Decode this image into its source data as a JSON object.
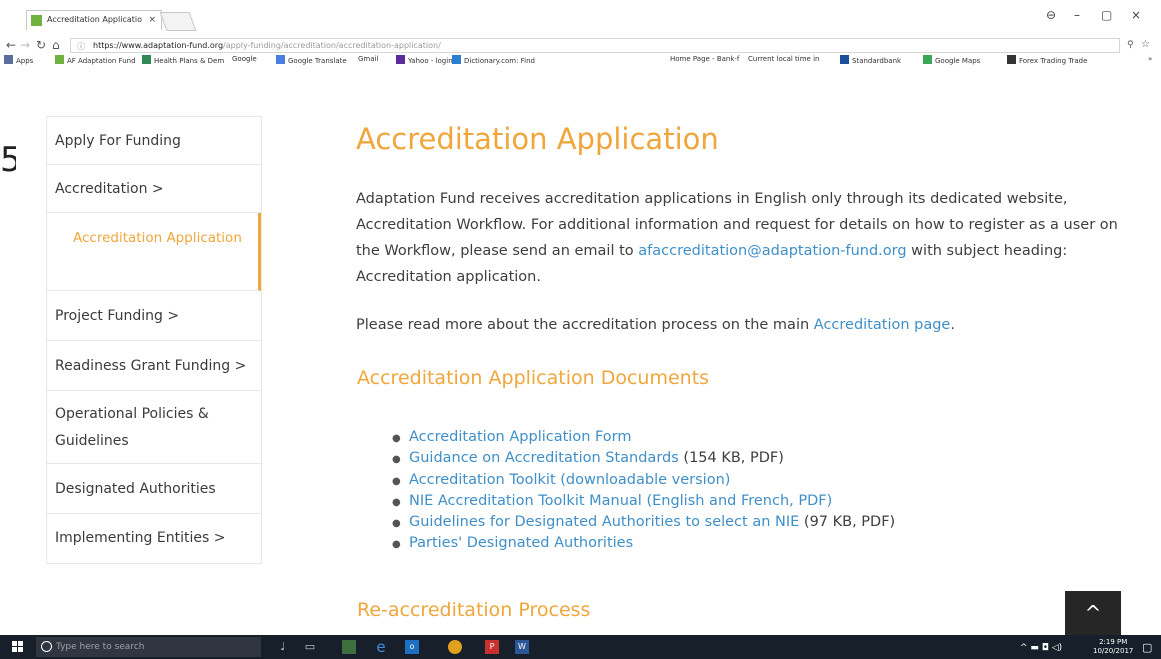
{
  "browser": {
    "tab_title": "Accreditation Applicatio",
    "tab_close": "×",
    "url_host": "https://www.adaptation-fund.org",
    "url_path": "/apply-funding/accreditation/accreditation-application/",
    "bookmarks": [
      "Apps",
      "AF Adaptation Fund",
      "Health Plans & Dem",
      "Google",
      "Google Translate",
      "Gmail",
      "Yahoo - login",
      "Dictionary.com: Find",
      "Home Page - Bank-f",
      "Current local time in",
      "Standardbank",
      "Google Maps",
      "Forex Trading Trade",
      "»"
    ]
  },
  "sidebar": {
    "items": [
      {
        "label": "Apply For Funding"
      },
      {
        "label": "Accreditation  >"
      },
      {
        "label": "Accreditation Application"
      },
      {
        "label": "Project Funding  >"
      },
      {
        "label": "Readiness Grant Funding  >"
      },
      {
        "label": "Operational Policies & Guidelines"
      },
      {
        "label": "Designated Authorities"
      },
      {
        "label": "Implementing Entities  >"
      }
    ]
  },
  "main": {
    "title": "Accreditation Application",
    "intro_1": "Adaptation Fund receives accreditation applications in English only through its dedicated website, Accreditation Workflow. For additional information and request for details on how to register as a user on the Workflow, please send an email to ",
    "intro_email": "afaccreditation@adaptation-fund.org",
    "intro_2": " with subject heading: Accreditation application.",
    "read_more_1": "Please read more about the accreditation process on the main ",
    "read_more_link": "Accreditation page",
    "read_more_2": ".",
    "docs_heading": "Accreditation Application Documents",
    "docs": [
      {
        "link": "Accreditation Application Form",
        "note": ""
      },
      {
        "link": "Guidance on Accreditation Standards",
        "note": " (154 KB, PDF)"
      },
      {
        "link": "Accreditation Toolkit (downloadable version)",
        "note": ""
      },
      {
        "link": "NIE Accreditation Toolkit Manual (English and French, PDF)",
        "note": ""
      },
      {
        "link": "Guidelines for Designated Authorities to select an NIE",
        "note": " (97 KB, PDF)"
      },
      {
        "link": "Parties' Designated Authorities",
        "note": ""
      }
    ],
    "reacc_heading": "Re-accreditation Process",
    "to_top": "^"
  },
  "taskbar": {
    "search_placeholder": "Type here to search",
    "time": "2:19 PM",
    "date": "10/20/2017"
  },
  "colors": {
    "accent": "#f0a63b",
    "link": "#3f8fc8"
  }
}
